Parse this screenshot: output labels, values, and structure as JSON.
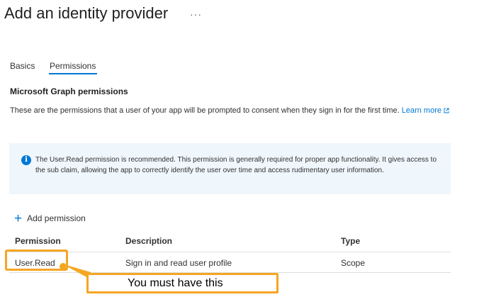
{
  "header": {
    "title": "Add an identity provider",
    "more_label": "···"
  },
  "tabs": [
    {
      "label": "Basics",
      "active": false
    },
    {
      "label": "Permissions",
      "active": true
    }
  ],
  "section": {
    "title": "Microsoft Graph permissions",
    "description": "These are the permissions that a user of your app will be prompted to consent when they sign in for the first time.",
    "link_text": "Learn more"
  },
  "info": {
    "icon": "info-icon",
    "text": "The User.Read permission is recommended. This permission is generally required for proper app functionality. It gives access to the sub claim, allowing the app to correctly identify the user over time and access rudimentary user information."
  },
  "add_permission": {
    "label": "Add permission",
    "icon": "plus-icon"
  },
  "table": {
    "columns": [
      "Permission",
      "Description",
      "Type"
    ],
    "rows": [
      {
        "permission": "User.Read",
        "description": "Sign in and read user profile",
        "type": "Scope"
      }
    ]
  },
  "callout": {
    "text": "You must have this",
    "color": "#f5a623"
  },
  "colors": {
    "accent": "#0078d4",
    "info_background": "#eff6fc",
    "callout": "#f5a623"
  }
}
